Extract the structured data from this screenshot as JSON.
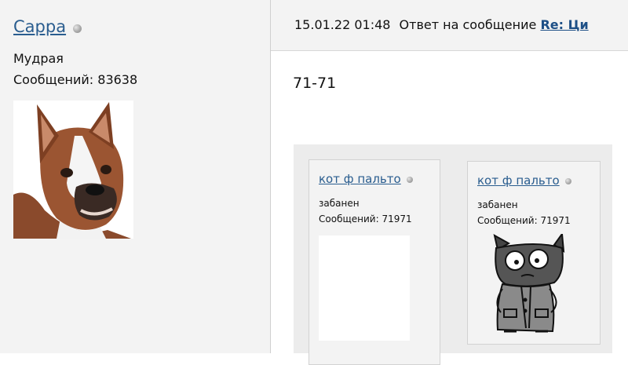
{
  "author": {
    "username": "Сарра",
    "rank": "Мудрая",
    "post_count_text": "Сообщений: 83638"
  },
  "post": {
    "date": "15.01.22 01:48",
    "reply_prefix": "Ответ на сообщение",
    "reply_link": "Re: Ци",
    "body": "71-71"
  },
  "quote": {
    "users": [
      {
        "username": "кот ф пальто",
        "rank": "забанен",
        "post_count_text": "Сообщений: 71971"
      },
      {
        "username": "кот ф пальто",
        "rank": "забанен",
        "post_count_text": "Сообщений: 71971"
      }
    ]
  },
  "colors": {
    "link": "#2a5d8f",
    "header_bg": "#f3f3f3",
    "quote_bg": "#ececec"
  }
}
